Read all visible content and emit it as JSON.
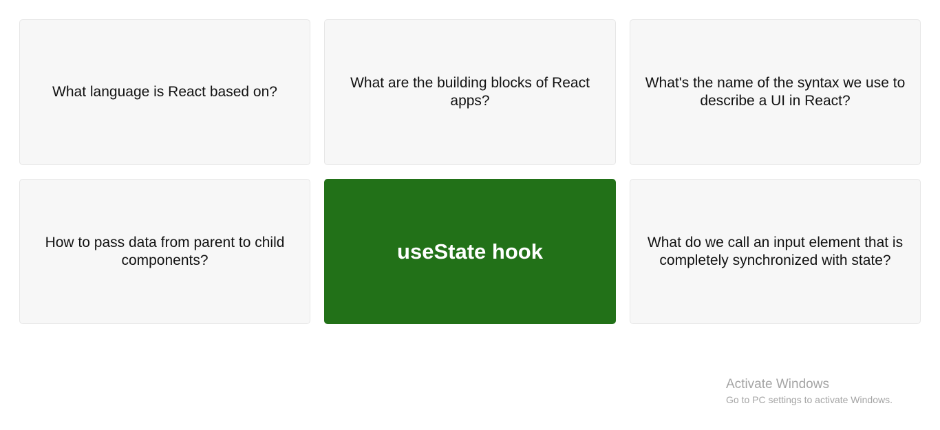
{
  "flashcards": [
    {
      "text": "What language is React based on?",
      "selected": false
    },
    {
      "text": "What are the building blocks of React apps?",
      "selected": false
    },
    {
      "text": "What's the name of the syntax we use to describe a UI in React?",
      "selected": false
    },
    {
      "text": "How to pass data from parent to child components?",
      "selected": false
    },
    {
      "text": "useState hook",
      "selected": true
    },
    {
      "text": "What do we call an input element that is completely synchronized with state?",
      "selected": false
    }
  ],
  "colors": {
    "card_background": "#f7f7f7",
    "card_border": "#e6e6e6",
    "selected_background": "#227118",
    "selected_text": "#ffffff",
    "text": "#111111"
  },
  "watermark": {
    "title": "Activate Windows",
    "subtitle": "Go to PC settings to activate Windows."
  }
}
